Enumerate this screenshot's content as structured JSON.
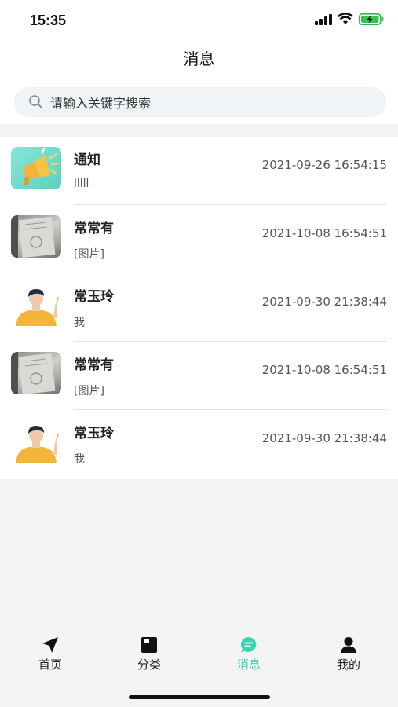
{
  "status": {
    "time": "15:35"
  },
  "header": {
    "title": "消息"
  },
  "search": {
    "placeholder": "请输入关键字搜索"
  },
  "messages": [
    {
      "name": "通知",
      "time": "2021-09-26 16:54:15",
      "preview": "lllll",
      "avatar": "megaphone"
    },
    {
      "name": "常常有",
      "time": "2021-10-08 16:54:51",
      "preview": "[图片]",
      "avatar": "photo"
    },
    {
      "name": "常玉玲",
      "time": "2021-09-30 21:38:44",
      "preview": "我",
      "avatar": "person"
    },
    {
      "name": "常常有",
      "time": "2021-10-08 16:54:51",
      "preview": "[图片]",
      "avatar": "photo"
    },
    {
      "name": "常玉玲",
      "time": "2021-09-30 21:38:44",
      "preview": "我",
      "avatar": "person"
    }
  ],
  "tabs": [
    {
      "label": "首页",
      "icon": "navigation-arrow-icon"
    },
    {
      "label": "分类",
      "icon": "floppy-icon"
    },
    {
      "label": "消息",
      "icon": "chat-bubble-icon",
      "active": true
    },
    {
      "label": "我的",
      "icon": "person-icon"
    }
  ],
  "colors": {
    "accent": "#3ed3b4",
    "notice_avatar": "#6fd8c8"
  }
}
